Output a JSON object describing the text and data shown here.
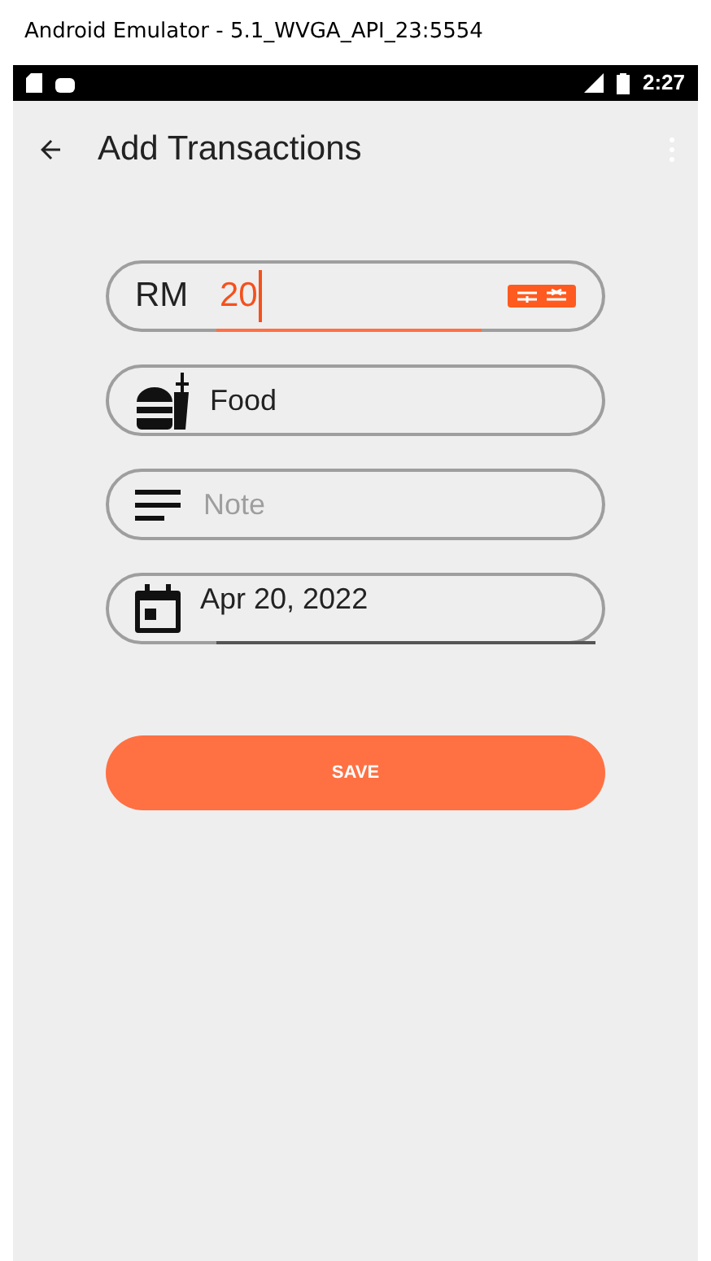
{
  "window": {
    "title": "Android Emulator - 5.1_WVGA_API_23:5554"
  },
  "status_bar": {
    "time": "2:27"
  },
  "app_bar": {
    "title": "Add Transactions"
  },
  "form": {
    "amount": {
      "prefix": "RM",
      "value": "20"
    },
    "category": {
      "value": "Food"
    },
    "note": {
      "placeholder": "Note"
    },
    "date": {
      "value": "Apr 20, 2022"
    }
  },
  "save_button": {
    "label": "SAVE"
  }
}
